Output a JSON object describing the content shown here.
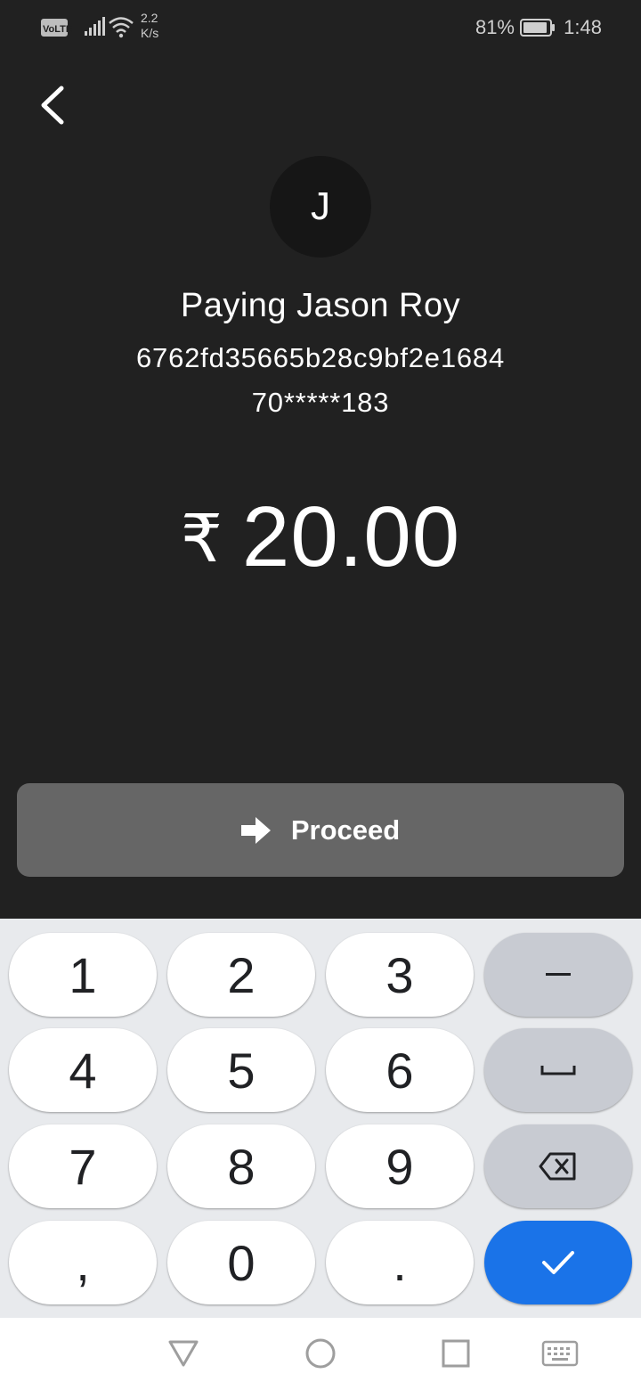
{
  "status_bar": {
    "volte": "VoLTE",
    "net_speed_value": "2.2",
    "net_speed_unit": "K/s",
    "battery": "81%",
    "time": "1:48"
  },
  "payee": {
    "initial": "J",
    "title": "Paying Jason Roy",
    "upi_id": "6762fd35665b28c9bf2e1684",
    "phone": "70*****183"
  },
  "amount": {
    "currency_symbol": "₹",
    "value": "20.00"
  },
  "proceed": {
    "label": "Proceed",
    "icon": "arrow-right-icon"
  },
  "keypad": {
    "keys": [
      "1",
      "2",
      "3",
      "4",
      "5",
      "6",
      "7",
      "8",
      "9",
      ",",
      "0",
      "."
    ],
    "minus": "−",
    "space_icon": "space-icon",
    "backspace_icon": "backspace-icon",
    "enter_icon": "check-icon"
  },
  "colors": {
    "background": "#212121",
    "proceed_button": "#666666",
    "keypad_background": "#e8eaed",
    "enter_key": "#1a73e8"
  },
  "nav_bar": {
    "back_icon": "triangle-back-icon",
    "home_icon": "circle-home-icon",
    "recents_icon": "square-recents-icon",
    "keyboard_icon": "keyboard-icon"
  }
}
